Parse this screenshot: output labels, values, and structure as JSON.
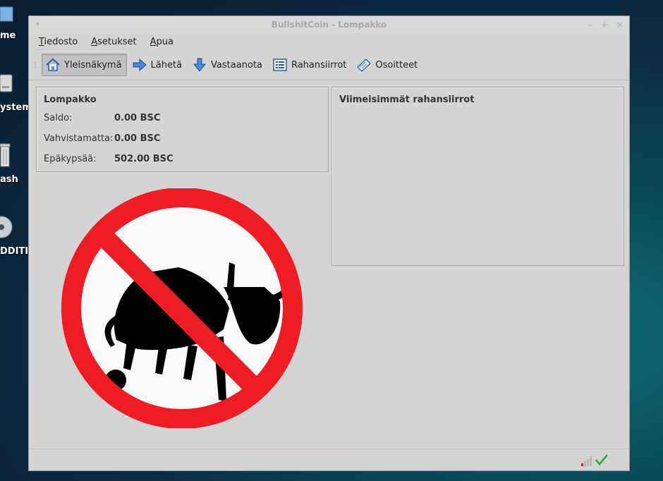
{
  "desktop": {
    "icons": [
      {
        "label": "me",
        "icon": "home-folder-icon"
      },
      {
        "label": "ystem",
        "icon": "drive-icon"
      },
      {
        "label": "ash",
        "icon": "trash-icon"
      },
      {
        "label": "DDITI…",
        "icon": "disc-icon"
      }
    ]
  },
  "window": {
    "title": "BullshitCoin - Lompakko",
    "controls": [
      "–",
      "+",
      "×"
    ]
  },
  "menubar": {
    "items": [
      {
        "label": "Tiedosto",
        "mnemonic": "T",
        "rest": "iedosto"
      },
      {
        "label": "Asetukset",
        "mnemonic": "A",
        "rest": "setukset"
      },
      {
        "label": "Apua",
        "mnemonic": "A",
        "rest": "pua"
      }
    ]
  },
  "toolbar": {
    "items": [
      {
        "label": "Yleisnäkymä",
        "icon": "home-icon",
        "active": true
      },
      {
        "label": "Lähetä",
        "icon": "arrow-right-icon",
        "active": false
      },
      {
        "label": "Vastaanota",
        "icon": "arrow-down-icon",
        "active": false
      },
      {
        "label": "Rahansiirrot",
        "icon": "list-icon",
        "active": false
      },
      {
        "label": "Osoitteet",
        "icon": "address-book-icon",
        "active": false
      }
    ]
  },
  "wallet": {
    "title": "Lompakko",
    "rows": [
      {
        "label": "Saldo:",
        "value": "0.00 BSC"
      },
      {
        "label": "Vahvistamatta:",
        "value": "0.00 BSC"
      },
      {
        "label": "Epäkypsää:",
        "value": "502.00 BSC"
      }
    ]
  },
  "recent": {
    "title": "Viimeisimmät rahansiirrot"
  },
  "logo": {
    "name": "no-bullshit-logo",
    "colors": {
      "ring": "#ee1c25",
      "fill": "#fafafa",
      "figure": "#000000"
    }
  },
  "status": {
    "icons": [
      "signal-bars-icon",
      "synced-check-icon"
    ]
  },
  "colors": {
    "window_bg": "#d4d4d4",
    "check": "#2fa830",
    "signal": "#cc2222"
  }
}
